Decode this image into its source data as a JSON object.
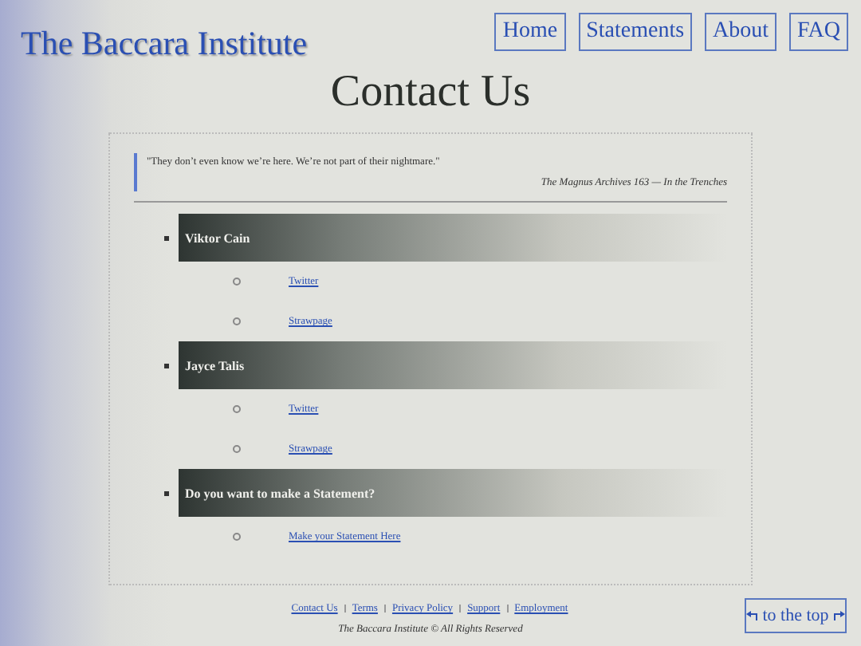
{
  "site_title": "The Baccara Institute",
  "nav": [
    {
      "label": "Home"
    },
    {
      "label": "Statements"
    },
    {
      "label": "About"
    },
    {
      "label": "FAQ"
    }
  ],
  "heading": "Contact Us",
  "quote": {
    "text": "\"They don’t even know we’re here. We’re not part of their nightmare.\"",
    "source": "The Magnus Archives 163 — In the Trenches"
  },
  "contacts": [
    {
      "name": "Viktor Cain",
      "links": [
        "Twitter",
        "Strawpage"
      ]
    },
    {
      "name": "Jayce Talis",
      "links": [
        "Twitter",
        "Strawpage"
      ]
    },
    {
      "name": "Do you want to make a Statement?",
      "links": [
        "Make your Statement Here"
      ]
    }
  ],
  "footer_links": [
    "Contact Us",
    "Terms",
    "Privacy Policy",
    "Support",
    "Employment"
  ],
  "copyright": "The Baccara Institute © All Rights Reserved",
  "to_top": "to the top"
}
